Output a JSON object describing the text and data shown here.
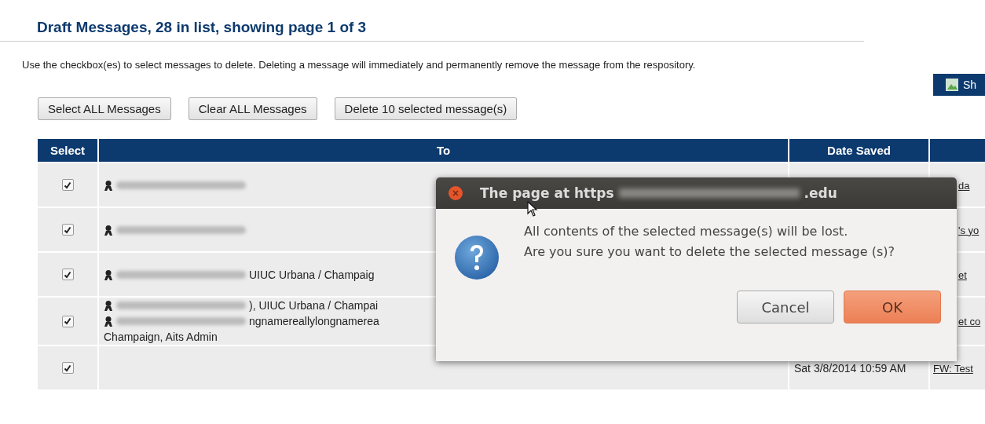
{
  "heading": "Draft Messages, 28 in list, showing page 1 of 3",
  "instructions": "Use the checkbox(es) to select messages to delete. Deleting a message will immediately and permanently remove the message from the respository.",
  "side_button": {
    "label": "Sh"
  },
  "actions": [
    "Select ALL Messages",
    "Clear ALL Messages",
    "Delete 10 selected message(s)"
  ],
  "table": {
    "columns": [
      "Select",
      "To",
      "Date Saved"
    ],
    "rows": [
      {
        "checked": true,
        "to": [
          {
            "kind": "recipient"
          }
        ],
        "subject": "da"
      },
      {
        "checked": true,
        "to": [
          {
            "kind": "recipient"
          }
        ],
        "subject": "'s yo"
      },
      {
        "checked": true,
        "to": [
          {
            "kind": "recipient",
            "text": "UIUC Urbana / Champaig"
          }
        ],
        "subject": "et"
      },
      {
        "checked": true,
        "to": [
          {
            "kind": "recipient",
            "text": "), UIUC Urbana / Champai"
          },
          {
            "kind": "recipient",
            "text": "ngnamereallylongnamerea"
          },
          {
            "kind": "text",
            "text": "Champaign, Aits Admin"
          }
        ],
        "subject": "et co"
      },
      {
        "checked": true,
        "to": [],
        "date": "Sat 3/8/2014 10:59 AM",
        "subject": "FW: Test"
      }
    ]
  },
  "dialog": {
    "title_start": "The page at https",
    "title_end": ".edu",
    "message": [
      "All contents of the selected message(s) will be lost.",
      "Are you sure you want to delete the selected message (s)?"
    ],
    "buttons": [
      {
        "label": "Cancel",
        "kind": "normal"
      },
      {
        "label": "OK",
        "kind": "default"
      }
    ]
  }
}
